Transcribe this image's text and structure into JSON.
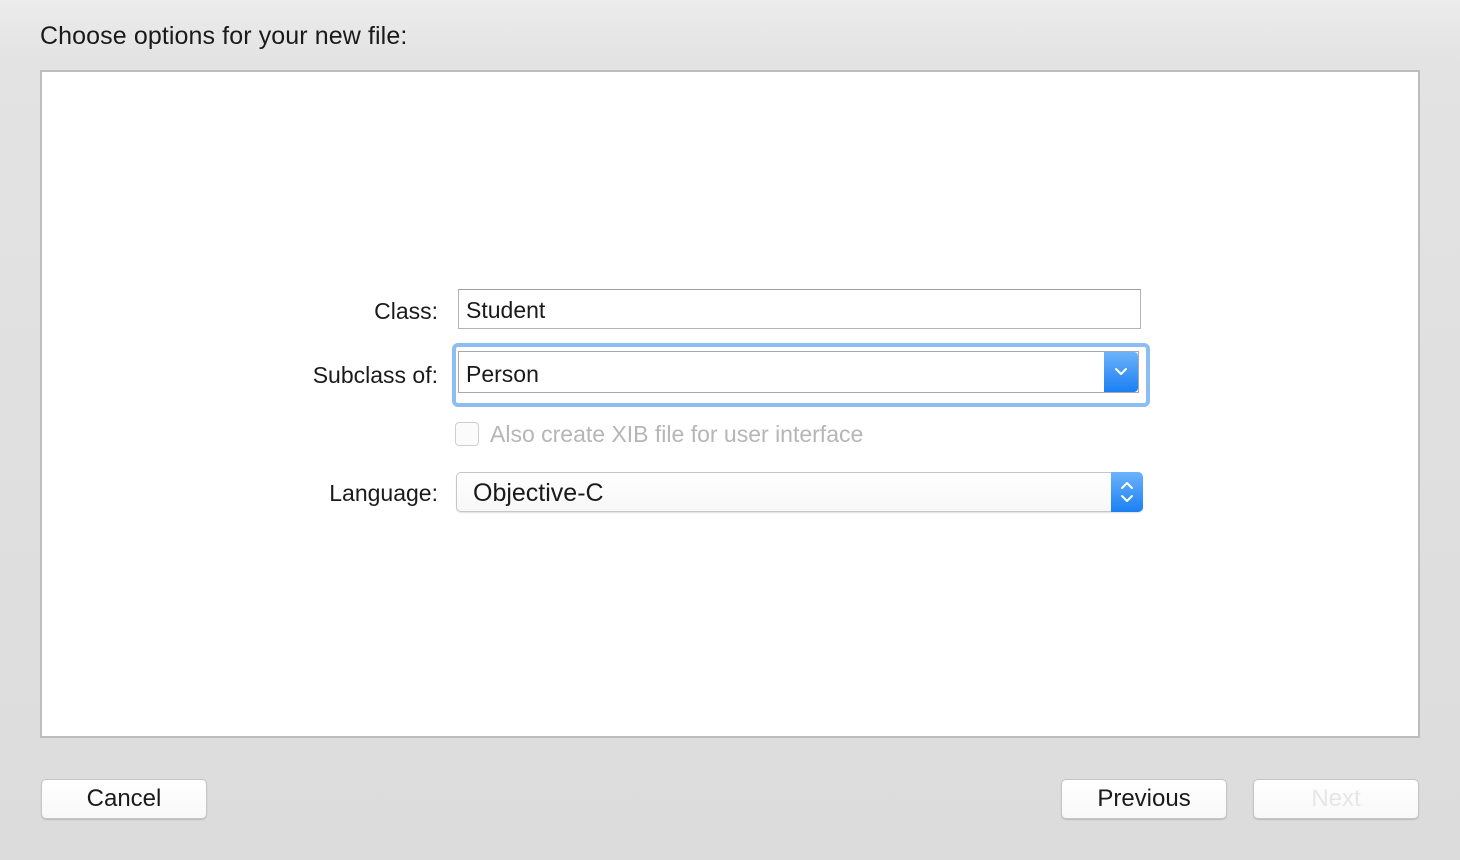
{
  "dialog": {
    "title": "Choose options for your new file:"
  },
  "form": {
    "class_label": "Class:",
    "class_value": "Student",
    "subclass_label": "Subclass of:",
    "subclass_value": "Person",
    "xib_checkbox_label": "Also create XIB file for user interface",
    "xib_checkbox_checked": false,
    "xib_checkbox_enabled": false,
    "language_label": "Language:",
    "language_value": "Objective-C"
  },
  "buttons": {
    "cancel_label": "Cancel",
    "previous_label": "Previous",
    "next_label": "Next",
    "next_enabled": false
  },
  "colors": {
    "accent": "#1b7ff3",
    "focus_ring": "#8cbdf3",
    "disabled_text": "#b6b6b6"
  },
  "icons": {
    "combo_button": "chevron-down-icon",
    "popup_button": "up-down-arrows-icon"
  }
}
